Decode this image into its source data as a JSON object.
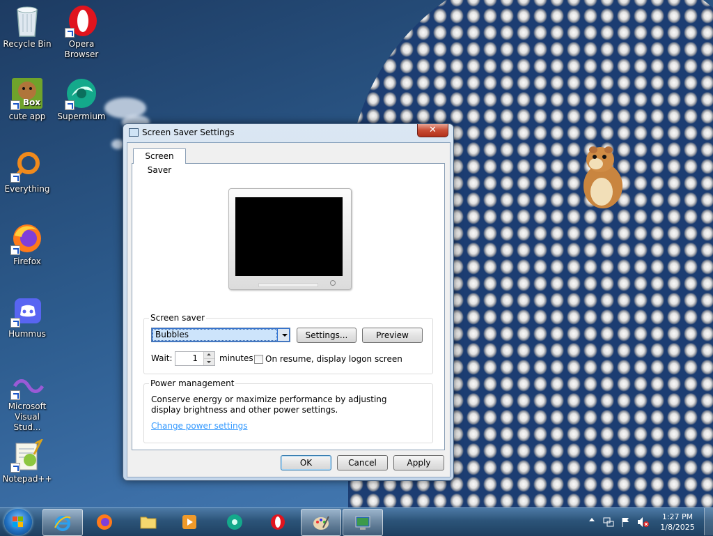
{
  "desktop": {
    "icons": [
      {
        "label": "Recycle Bin",
        "icon": "recycle-bin-icon"
      },
      {
        "label": "Opera\nBrowser",
        "icon": "opera-icon"
      },
      {
        "label": "cute app",
        "icon": "cute-app-icon",
        "badge": "Box"
      },
      {
        "label": "Supermium",
        "icon": "supermium-icon"
      },
      {
        "label": "Everything",
        "icon": "everything-icon"
      },
      {
        "label": "Firefox",
        "icon": "firefox-icon"
      },
      {
        "label": "Hummus",
        "icon": "discord-icon"
      },
      {
        "label": "Microsoft\nVisual Stud...",
        "icon": "visual-studio-icon"
      },
      {
        "label": "Notepad++",
        "icon": "notepadpp-icon"
      }
    ]
  },
  "dialog": {
    "title": "Screen Saver Settings",
    "close_glyph": "✕",
    "tab_label": "Screen Saver",
    "screen_saver_group": {
      "label": "Screen saver",
      "selected": "Bubbles",
      "settings_button": "Settings...",
      "preview_button": "Preview",
      "wait_label": "Wait:",
      "wait_value": "1",
      "minutes_label": "minutes",
      "resume_label": "On resume, display logon screen",
      "resume_checked": false
    },
    "power_group": {
      "label": "Power management",
      "description": "Conserve energy or maximize performance by adjusting display brightness and other power settings.",
      "link": "Change power settings"
    },
    "buttons": {
      "ok": "OK",
      "cancel": "Cancel",
      "apply": "Apply"
    }
  },
  "taskbar": {
    "items": [
      "start-button",
      "internet-explorer",
      "firefox",
      "file-explorer",
      "media-player",
      "supermium",
      "opera",
      "paint",
      "display-settings"
    ],
    "active_items": [
      "internet-explorer",
      "paint",
      "display-settings"
    ],
    "clock": {
      "time": "1:27 PM",
      "date": "1/8/2025"
    },
    "tray_icons": [
      "show-hidden-icons-arrow",
      "network-icon",
      "action-center-flag-icon",
      "volume-muted-icon"
    ]
  },
  "colors": {
    "link": "#3399ff",
    "taskbar": "#2c5479",
    "selection": "#cde4fb"
  }
}
